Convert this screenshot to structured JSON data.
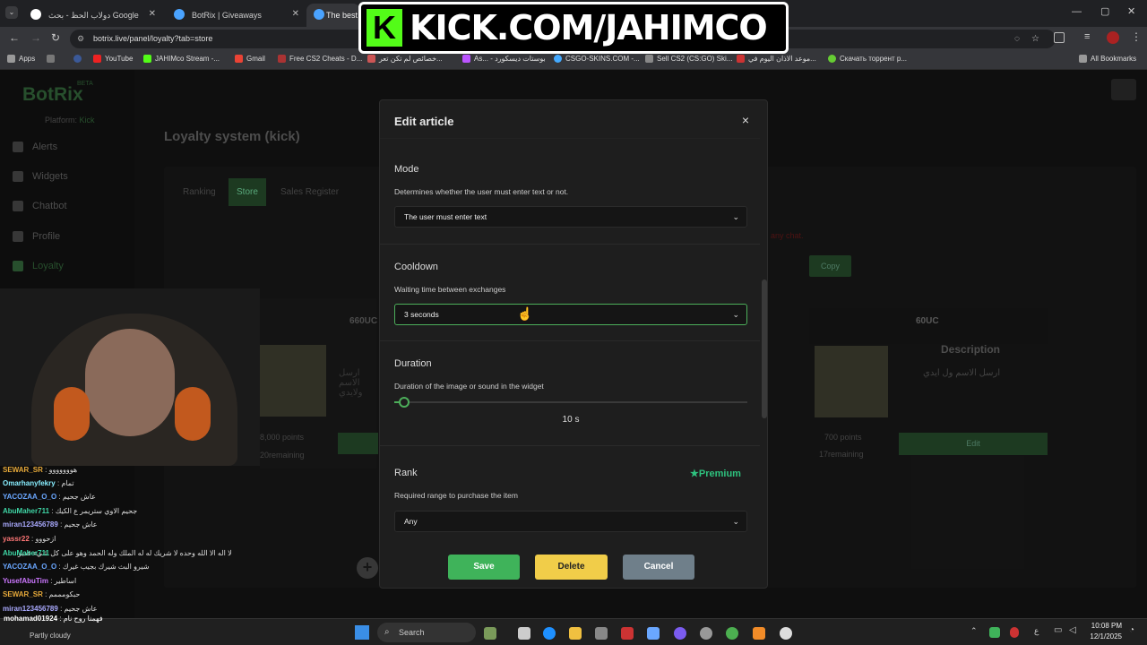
{
  "browser": {
    "tabs": [
      {
        "title": "دولاب الحظ - بحث Google"
      },
      {
        "title": "BotRix | Giveaways"
      },
      {
        "title": "The best"
      }
    ],
    "url": "botrix.live/panel/loyalty?tab=store",
    "bookmarks": [
      "Apps",
      "YouTube",
      "JAHIMco Stream -...",
      "Gmail",
      "Free CS2 Cheats - D...",
      "خصائص لم تكن تعر...",
      "As... - بوستات ديسكورد",
      "CSGO-SKINS.COM -...",
      "Sell CS2 (CS:GO) Ski...",
      "موعد الاذان اليوم في...",
      "Скачать торрент p..."
    ],
    "all_bookmarks": "All Bookmarks"
  },
  "stream_banner": "KICK.COM/JAHIMCO",
  "sidebar": {
    "logo": "BotRix",
    "beta": "BETA",
    "platform_label": "Platform:",
    "platform_value": "Kick",
    "items": [
      {
        "label": "Alerts"
      },
      {
        "label": "Widgets"
      },
      {
        "label": "Chatbot"
      },
      {
        "label": "Profile"
      },
      {
        "label": "Loyalty"
      }
    ]
  },
  "page": {
    "title": "Loyalty system (kick)",
    "tabs": [
      "Ranking",
      "Store",
      "Sales Register"
    ],
    "copy_button": "Copy",
    "notice": "any chat.",
    "items": [
      {
        "title": "660UC",
        "description": "ارسل الاسم ولايدي",
        "points": "8,000 points",
        "remaining": "20remaining"
      },
      {
        "title": "60UC",
        "description_heading": "Description",
        "description": "ارسل الاسم ول ايدي",
        "points": "700 points",
        "remaining": "17remaining",
        "edit": "Edit"
      }
    ]
  },
  "modal": {
    "title": "Edit article",
    "close": "×",
    "mode": {
      "title": "Mode",
      "desc": "Determines whether the user must enter text or not.",
      "value": "The user must enter text"
    },
    "cooldown": {
      "title": "Cooldown",
      "desc": "Waiting time between exchanges",
      "value": "3 seconds"
    },
    "duration": {
      "title": "Duration",
      "desc": "Duration of the image or sound in the widget",
      "value": "10 s",
      "slider_fraction": 0.02
    },
    "rank": {
      "title": "Rank",
      "badge": "Premium",
      "desc": "Required range to purchase the item",
      "value": "Any"
    },
    "buttons": {
      "save": "Save",
      "delete": "Delete",
      "cancel": "Cancel"
    }
  },
  "chat": [
    {
      "user": "SEWAR_SR",
      "msg": ": هووووووو"
    },
    {
      "user": "Omarhanyfekry",
      "msg": ": تمام"
    },
    {
      "user": "YACOZAA_O_O",
      "msg": ": عاش جحيم"
    },
    {
      "user": "AbuMaher711",
      "msg": ": جحيم الاوي ستريمر ع الكيك"
    },
    {
      "user": "miran123456789",
      "msg": ": عاش جحيم"
    },
    {
      "user": "yassr22",
      "msg": ": ازحووو"
    },
    {
      "user": "",
      "msg": "لا اله الا الله وحده لا شريك له له الملك وله الحمد وهو على كل شيء قدير"
    },
    {
      "user": "AbuMaher711",
      "msg": ""
    },
    {
      "user": "YACOZAA_O_O",
      "msg": ": شيرو البث شيرك بجيب غيرك"
    },
    {
      "user": "YusefAbuTim",
      "msg": ": اساطير"
    },
    {
      "user": "SEWAR_SR",
      "msg": ": حبكومممم"
    },
    {
      "user": "miran123456789",
      "msg": ": عاش جحيم"
    },
    {
      "user": "mohamad01924",
      "msg": ": فهمنا روح نام"
    }
  ],
  "taskbar": {
    "weather": "Partly cloudy",
    "search": "Search",
    "time": "10:08 PM",
    "date": "12/1/2025",
    "lang": "ع"
  },
  "colors": {
    "accent_green": "#53c265",
    "kick_green": "#53fc18",
    "delete_yellow": "#f1cd49",
    "cancel_gray": "#6f7f8a",
    "premium": "#2ec27e"
  }
}
